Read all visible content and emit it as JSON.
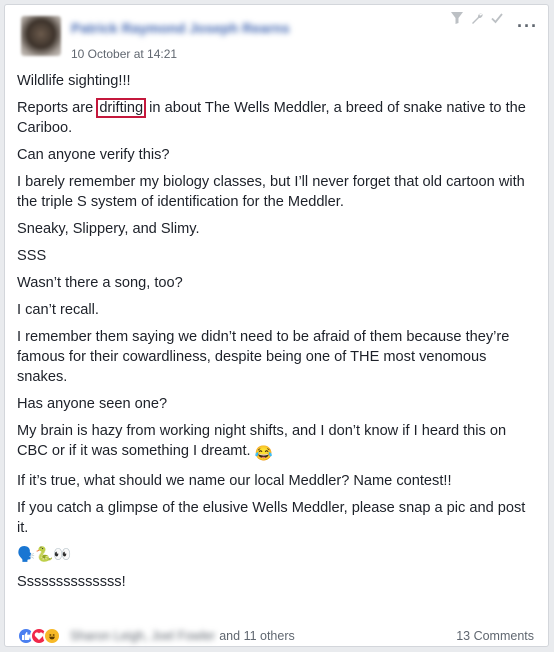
{
  "post": {
    "author_name": "Patrick Raymond Joseph Rearns",
    "timestamp": "10 October at 14:21",
    "lines": {
      "l1": "Wildlife sighting!!!",
      "l2_before": "Reports are ",
      "l2_highlight": "drifting",
      "l2_after": " in about The Wells Meddler, a breed of snake native to the Cariboo.",
      "l3": "Can anyone verify this?",
      "l4": "I barely remember my biology classes, but I’ll never forget that old cartoon with the triple S system of identification for the Meddler.",
      "l5": "Sneaky, Slippery, and Slimy.",
      "l6": "SSS",
      "l7": "Wasn’t there a song, too?",
      "l8": "I can’t recall.",
      "l9": "I remember them saying we didn’t need to be afraid of them because they’re famous for their cowardliness, despite being one of THE most venomous snakes.",
      "l10": "Has anyone seen one?",
      "l11": "My brain is hazy from working night shifts, and I don’t know if I heard this on CBC or if it was something I dreamt.",
      "l12": "If it’s true, what should we name our local Meddler? Name contest!!",
      "l13": "If you catch a glimpse of the elusive Wells Meddler, please snap a pic and post it.",
      "l14": "🗣️🐍👀",
      "l15": "Ssssssssssssss!"
    },
    "laugh_emoji": "😂"
  },
  "footer": {
    "reaction_names": "Sharon Leigh, Joel Fowler",
    "others_text": "and 11 others",
    "comments_text": "13 Comments"
  },
  "icons": [
    "filter-icon",
    "wrench-icon",
    "checkmark-icon",
    "more-options-icon",
    "like-icon",
    "love-icon",
    "haha-icon"
  ],
  "colors": {
    "link": "#4267b2",
    "highlight_box": "#c4183c",
    "meta": "#606770"
  }
}
